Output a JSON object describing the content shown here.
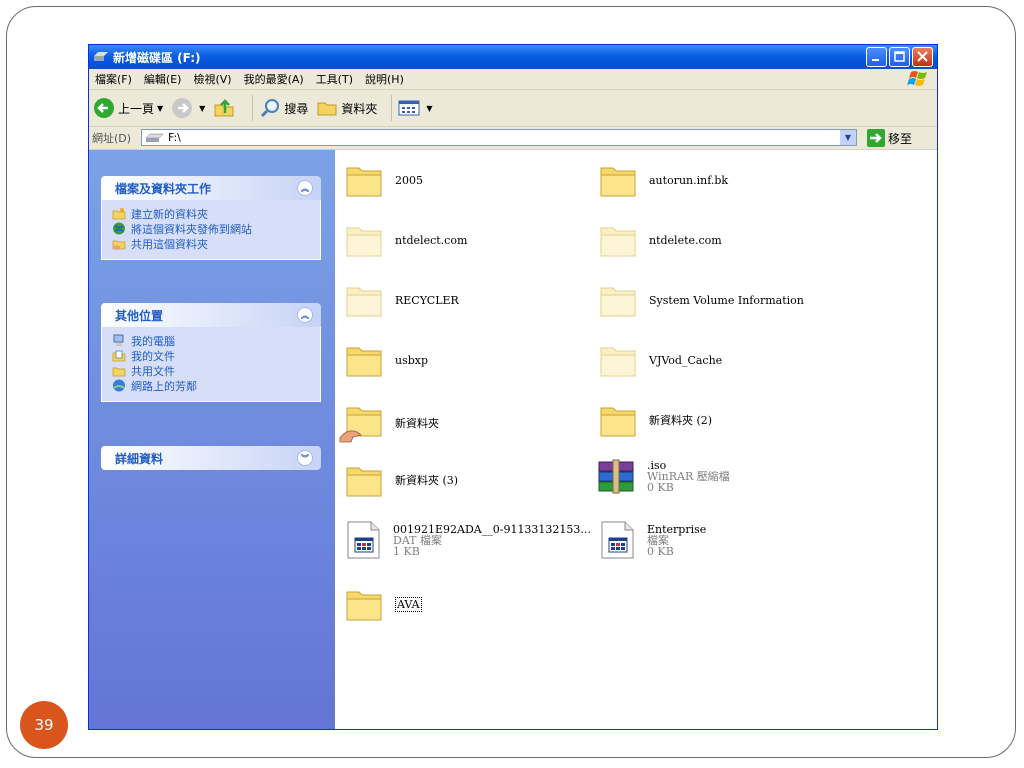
{
  "window": {
    "title": "新增磁碟區 (F:)"
  },
  "menu": [
    "檔案(F)",
    "編輯(E)",
    "檢視(V)",
    "我的最愛(A)",
    "工具(T)",
    "說明(H)"
  ],
  "toolbar": {
    "back": "上一頁",
    "search": "搜尋",
    "folders": "資料夾"
  },
  "address": {
    "label": "網址(D)",
    "value": "F:\\",
    "go": "移至"
  },
  "tasks": {
    "file_folder": {
      "title": "檔案及資料夾工作",
      "links": [
        "建立新的資料夾",
        "將這個資料夾發佈到網站",
        "共用這個資料夾"
      ]
    },
    "other_places": {
      "title": "其他位置",
      "links": [
        "我的電腦",
        "我的文件",
        "共用文件",
        "網路上的芳鄰"
      ]
    },
    "details": {
      "title": "詳細資料"
    }
  },
  "files": [
    {
      "name": "2005"
    },
    {
      "name": "autorun.inf.bk"
    },
    {
      "name": "ntdelect.com"
    },
    {
      "name": "ntdelete.com"
    },
    {
      "name": "RECYCLER"
    },
    {
      "name": "System Volume Information"
    },
    {
      "name": "usbxp"
    },
    {
      "name": "VJVod_Cache"
    },
    {
      "name": "新資料夾"
    },
    {
      "name": "新資料夾 (2)"
    },
    {
      "name": "新資料夾 (3)"
    },
    {
      "name": ".iso",
      "type": "WinRAR 壓縮檔",
      "size": "0 KB"
    },
    {
      "name": "001921E92ADA__0-91133132153...",
      "type": "DAT 檔案",
      "size": "1 KB"
    },
    {
      "name": "Enterprise",
      "type": "檔案",
      "size": "0 KB"
    },
    {
      "name": "AVA"
    }
  ],
  "slide": {
    "page_number": "39"
  }
}
